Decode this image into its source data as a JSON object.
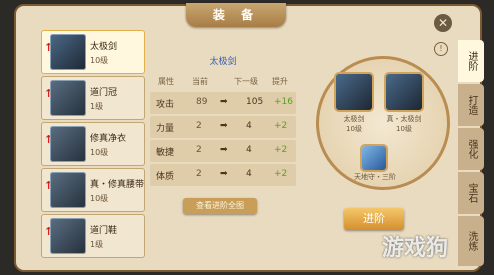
{
  "window": {
    "title": "装 备",
    "close_icon": "close-icon"
  },
  "equipment_list": [
    {
      "name": "太极剑",
      "level": "10级",
      "icon": "sword-icon",
      "selected": true,
      "upgradable": true
    },
    {
      "name": "道门冠",
      "level": "1级",
      "icon": "helmet-icon",
      "selected": false,
      "upgradable": true
    },
    {
      "name": "修真净衣",
      "level": "10级",
      "icon": "armor-icon",
      "selected": false,
      "upgradable": true
    },
    {
      "name": "真・修真腰带",
      "level": "10级",
      "icon": "belt-icon",
      "selected": false,
      "upgradable": true
    },
    {
      "name": "道门鞋",
      "level": "1级",
      "icon": "boots-icon",
      "selected": false,
      "upgradable": true
    }
  ],
  "stats": {
    "title": "太极剑",
    "headers": [
      "属性",
      "当前",
      "",
      "下一级",
      "提升"
    ],
    "rows": [
      {
        "attr": "攻击",
        "current": "89",
        "next": "105",
        "gain": "+16"
      },
      {
        "attr": "力量",
        "current": "2",
        "next": "4",
        "gain": "+2"
      },
      {
        "attr": "敏捷",
        "current": "2",
        "next": "4",
        "gain": "+2"
      },
      {
        "attr": "体质",
        "current": "2",
        "next": "4",
        "gain": "+2"
      }
    ],
    "preview_button": "查看进阶全图"
  },
  "advance": {
    "slot_left": {
      "name": "太极剑",
      "level": "10级"
    },
    "slot_right": {
      "name": "真・太极剑",
      "level": "10级"
    },
    "material": {
      "name": "天地守・三阶"
    },
    "button": "进阶"
  },
  "tabs": [
    "进阶",
    "打造",
    "强化",
    "宝石",
    "洗炼"
  ],
  "active_tab": "进阶",
  "watermark": "游戏狗",
  "colors": {
    "gain": "#5aa028",
    "title_blue": "#3a60b0",
    "button": "#d58f2e"
  }
}
